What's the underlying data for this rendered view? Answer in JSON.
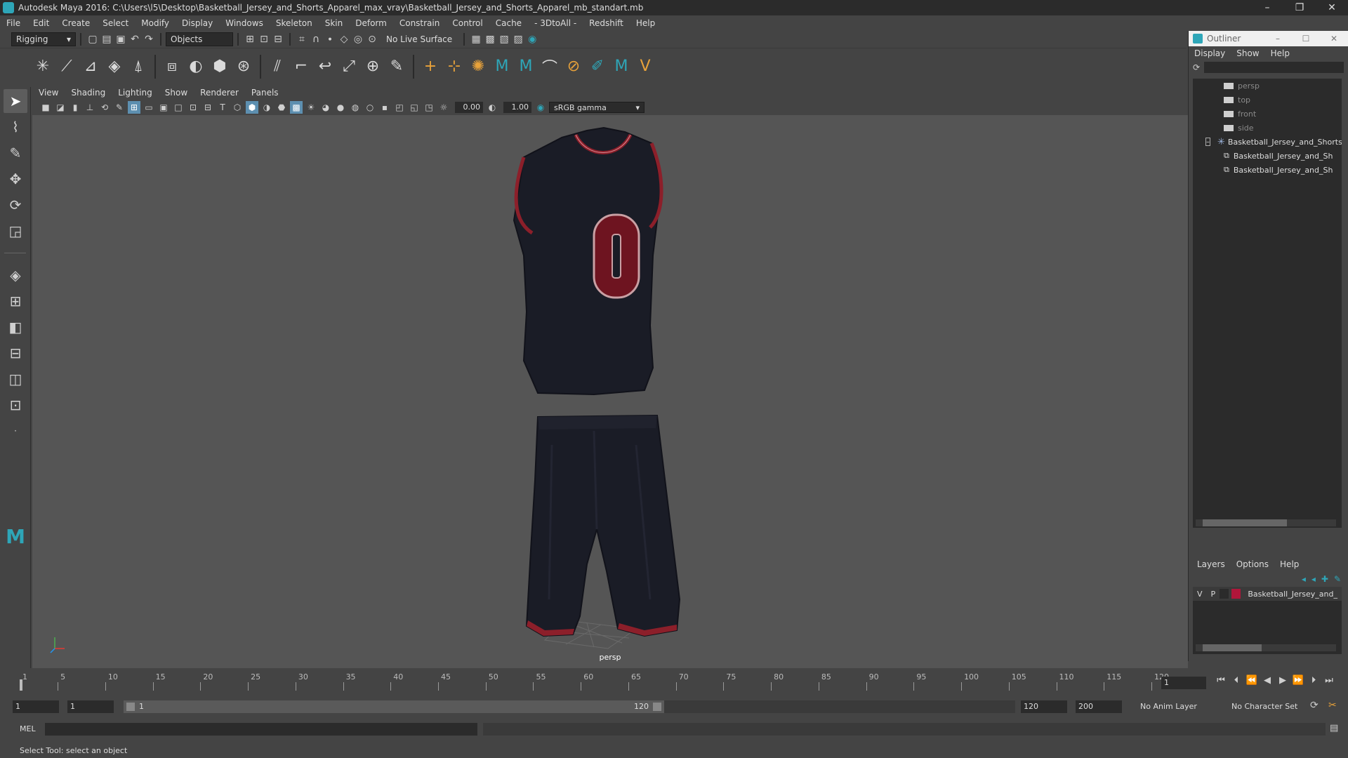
{
  "window": {
    "title": "Autodesk Maya 2016: C:\\Users\\l5\\Desktop\\Basketball_Jersey_and_Shorts_Apparel_max_vray\\Basketball_Jersey_and_Shorts_Apparel_mb_standart.mb"
  },
  "menubar": [
    "File",
    "Edit",
    "Create",
    "Select",
    "Modify",
    "Display",
    "Windows",
    "Skeleton",
    "Skin",
    "Deform",
    "Constrain",
    "Control",
    "Cache",
    "- 3DtoAll -",
    "Redshift",
    "Help"
  ],
  "statusline": {
    "menuset": "Rigging",
    "selection_mode": "Objects",
    "live_surface": "No Live Surface"
  },
  "panel": {
    "menus": [
      "View",
      "Shading",
      "Lighting",
      "Show",
      "Renderer",
      "Panels"
    ],
    "exposure": "0.00",
    "gamma": "1.00",
    "color_space": "sRGB gamma",
    "camera_label": "persp"
  },
  "outliner": {
    "title": "Outliner",
    "menus": [
      "Display",
      "Show",
      "Help"
    ],
    "items": [
      {
        "label": "persp"
      },
      {
        "label": "top"
      },
      {
        "label": "front"
      },
      {
        "label": "side"
      },
      {
        "label": "Basketball_Jersey_and_Shorts"
      },
      {
        "label": "Basketball_Jersey_and_Sh"
      },
      {
        "label": "Basketball_Jersey_and_Sh"
      }
    ]
  },
  "layers": {
    "menus": [
      "Layers",
      "Options",
      "Help"
    ],
    "row": {
      "v": "V",
      "p": "P",
      "name": "Basketball_Jersey_and_",
      "color": "#b0163a"
    }
  },
  "timeline": {
    "ticks": [
      "1",
      "5",
      "10",
      "15",
      "20",
      "25",
      "30",
      "35",
      "40",
      "45",
      "50",
      "55",
      "60",
      "65",
      "70",
      "75",
      "80",
      "85",
      "90",
      "95",
      "100",
      "105",
      "110",
      "115",
      "120"
    ],
    "current_frame": "1"
  },
  "range": {
    "start": "1",
    "start_inner": "1",
    "bar_start": "1",
    "bar_end": "120",
    "end_inner": "120",
    "end": "200",
    "anim_layer": "No Anim Layer",
    "character_set": "No Character Set"
  },
  "cmdline": {
    "lang": "MEL"
  },
  "helpline": {
    "text": "Select Tool: select an object"
  },
  "colors": {
    "accent": "#2ea6b8",
    "jersey": "#1a1c26",
    "trim": "#8c1f2a"
  }
}
